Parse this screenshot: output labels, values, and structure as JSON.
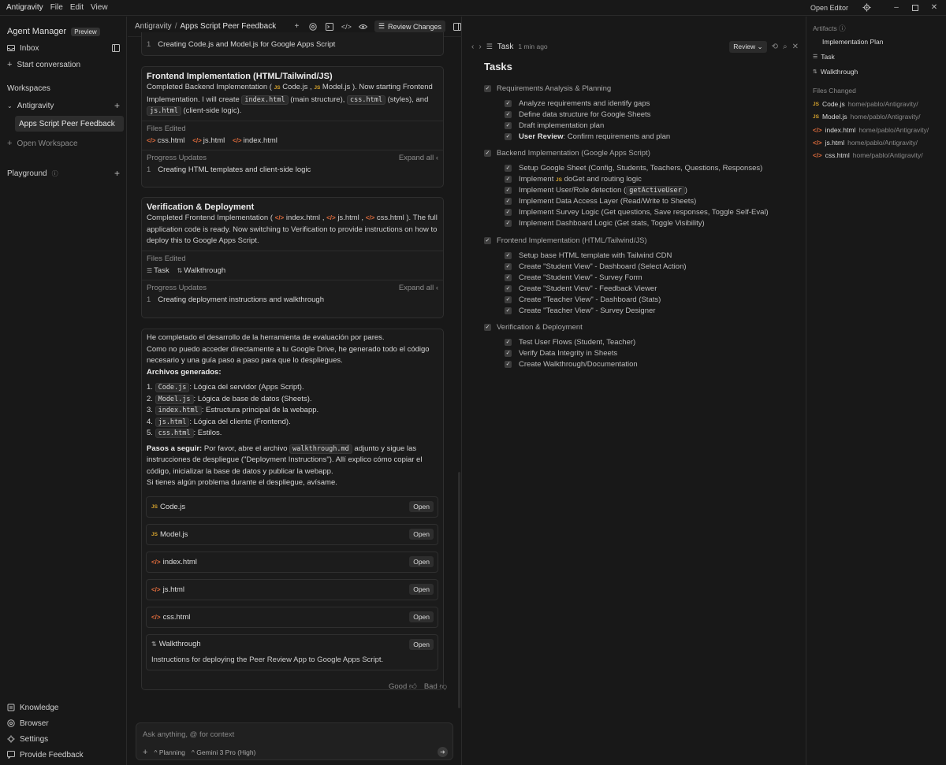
{
  "titlebar": {
    "app_name": "Antigravity",
    "menu": [
      "File",
      "Edit",
      "View"
    ],
    "open_editor": "Open Editor"
  },
  "sidebar": {
    "agent_manager": "Agent Manager",
    "preview_badge": "Preview",
    "inbox": "Inbox",
    "start_conversation": "Start conversation",
    "workspaces": "Workspaces",
    "workspace_name": "Antigravity",
    "selected_item": "Apps Script Peer Feedback",
    "open_workspace": "Open Workspace",
    "playground": "Playground",
    "bottom": [
      "Knowledge",
      "Browser",
      "Settings",
      "Provide Feedback"
    ]
  },
  "chat": {
    "breadcrumb_root": "Antigravity",
    "breadcrumb_sep": "/",
    "breadcrumb_current": "Apps Script Peer Feedback",
    "review_changes": "Review Changes",
    "top_item_num": "1",
    "top_item": "Creating Code.js and Model.js for Google Apps Script",
    "frontend": {
      "title": "Frontend Implementation (HTML/Tailwind/JS)",
      "body_a": "Completed Backend Implementation (",
      "code_js": "Code.js",
      "comma": ",",
      "model_js": "Model.js",
      "body_b": "). Now starting Frontend Implementation. I will create",
      "index_html": "index.html",
      "body_c": "(main structure),",
      "css_html": "css.html",
      "body_d": "(styles), and",
      "js_html": "js.html",
      "body_e": "(client-side logic).",
      "files_edited": "Files Edited",
      "files": [
        "css.html",
        "js.html",
        "index.html"
      ],
      "progress_updates": "Progress Updates",
      "expand_all": "Expand all",
      "item_num": "1",
      "item": "Creating HTML templates and client-side logic"
    },
    "verification": {
      "title": "Verification & Deployment",
      "body_a": "Completed Frontend Implementation (",
      "f1": "index.html",
      "f2": "js.html",
      "f3": "css.html",
      "comma": ",",
      "body_b": "). The full application code is ready. Now switching to Verification to provide instructions on how to deploy this to Google Apps Script.",
      "files_edited": "Files Edited",
      "files": [
        "Task",
        "Walkthrough"
      ],
      "progress_updates": "Progress Updates",
      "expand_all": "Expand all",
      "item_num": "1",
      "item": "Creating deployment instructions and walkthrough"
    },
    "final": {
      "p1": "He completado el desarrollo de la herramienta de evaluación por pares.",
      "p2": "Como no puedo acceder directamente a tu Google Drive, he generado todo el código necesario y una guía paso a paso para que lo despliegues.",
      "generated_heading": "Archivos generados:",
      "list": [
        {
          "num": "1.",
          "code": "Code.js",
          "text": ": Lógica del servidor (Apps Script)."
        },
        {
          "num": "2.",
          "code": "Model.js",
          "text": ": Lógica de base de datos (Sheets)."
        },
        {
          "num": "3.",
          "code": "index.html",
          "text": ": Estructura principal de la webapp."
        },
        {
          "num": "4.",
          "code": "js.html",
          "text": ": Lógica del cliente (Frontend)."
        },
        {
          "num": "5.",
          "code": "css.html",
          "text": ": Estilos."
        }
      ],
      "next_label": "Pasos a seguir:",
      "next_a": "Por favor, abre el archivo",
      "next_code": "walkthrough.md",
      "next_b": "adjunto y sigue las instrucciones de despliegue (\"Deployment Instructions\"). Allí explico cómo copiar el código, inicializar la base de datos y publicar la webapp.",
      "next_c": "Si tienes algún problema durante el despliegue, avísame.",
      "attachments": [
        "Code.js",
        "Model.js",
        "index.html",
        "js.html",
        "css.html",
        "Walkthrough"
      ],
      "open_label": "Open",
      "walkthrough_desc": "Instructions for deploying the Peer Review App to Google Apps Script."
    },
    "good": "Good",
    "bad": "Bad",
    "composer_placeholder": "Ask anything, @ for context",
    "planning": "Planning",
    "model": "Gemini 3 Pro (High)"
  },
  "task": {
    "tab_label": "Task",
    "time": "1 min ago",
    "review_btn": "Review",
    "heading": "Tasks",
    "sections": [
      {
        "title": "Requirements Analysis & Planning",
        "items": [
          {
            "text": "Analyze requirements and identify gaps"
          },
          {
            "text": "Define data structure for Google Sheets"
          },
          {
            "text": "Draft implementation plan"
          },
          {
            "bold": "User Review",
            "text": ": Confirm requirements and plan"
          }
        ]
      },
      {
        "title": "Backend Implementation (Google Apps Script)",
        "items": [
          {
            "text": "Setup Google Sheet (Config, Students, Teachers, Questions, Responses)"
          },
          {
            "pre": "Implement",
            "code": "doGet",
            "text": "and routing logic"
          },
          {
            "pre": "Implement User/Role detection (",
            "code2": "getActiveUser",
            "text": ")"
          },
          {
            "text": "Implement Data Access Layer (Read/Write to Sheets)"
          },
          {
            "text": "Implement Survey Logic (Get questions, Save responses, Toggle Self-Eval)"
          },
          {
            "text": "Implement Dashboard Logic (Get stats, Toggle Visibility)"
          }
        ]
      },
      {
        "title": "Frontend Implementation (HTML/Tailwind/JS)",
        "items": [
          {
            "text": "Setup base HTML template with Tailwind CDN"
          },
          {
            "text": "Create \"Student View\" - Dashboard (Select Action)"
          },
          {
            "text": "Create \"Student View\" - Survey Form"
          },
          {
            "text": "Create \"Student View\" - Feedback Viewer"
          },
          {
            "text": "Create \"Teacher View\" - Dashboard (Stats)"
          },
          {
            "text": "Create \"Teacher View\" - Survey Designer"
          }
        ]
      },
      {
        "title": "Verification & Deployment",
        "items": [
          {
            "text": "Test User Flows (Student, Teacher)"
          },
          {
            "text": "Verify Data Integrity in Sheets"
          },
          {
            "text": "Create Walkthrough/Documentation"
          }
        ]
      }
    ]
  },
  "artifacts": {
    "heading": "Artifacts",
    "items": [
      "Implementation Plan",
      "Task",
      "Walkthrough"
    ],
    "files_changed": "Files Changed",
    "files": [
      {
        "name": "Code.js",
        "path": "home/pablo/Antigravity/"
      },
      {
        "name": "Model.js",
        "path": "home/pablo/Antigravity/"
      },
      {
        "name": "index.html",
        "path": "home/pablo/Antigravity/"
      },
      {
        "name": "js.html",
        "path": "home/pablo/Antigravity/"
      },
      {
        "name": "css.html",
        "path": "home/pablo/Antigravity/"
      }
    ]
  },
  "colors": {
    "html_icon": "#e06c3c",
    "js_icon": "#d6a32d",
    "background": "#181818"
  }
}
